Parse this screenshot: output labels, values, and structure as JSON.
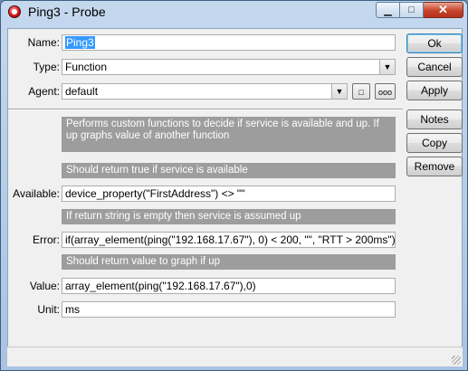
{
  "window": {
    "title": "Ping3 - Probe"
  },
  "form": {
    "name_label": "Name:",
    "name_value": "Ping3",
    "type_label": "Type:",
    "type_value": "Function",
    "agent_label": "Agent:",
    "agent_value": "default",
    "agent_btn1": "□",
    "agent_btn2": "ooo",
    "info_description": "Performs custom functions to decide if service is available and up. If up graphs value of another function",
    "info_available": "Should return true if service is available",
    "available_label": "Available:",
    "available_value": "device_property(\"FirstAddress\") <> \"\"",
    "info_error": "If return string is empty then service is assumed up",
    "error_label": "Error:",
    "error_value": "if(array_element(ping(\"192.168.17.67\"), 0) < 200, \"\", \"RTT > 200ms\")",
    "info_value": "Should return value to graph if up",
    "value_label": "Value:",
    "value_value": "array_element(ping(\"192.168.17.67\"),0)",
    "unit_label": "Unit:",
    "unit_value": "ms"
  },
  "buttons": {
    "ok": "Ok",
    "cancel": "Cancel",
    "apply": "Apply",
    "notes": "Notes",
    "copy": "Copy",
    "remove": "Remove"
  },
  "icons": {
    "app": "probe-icon",
    "minimize": "minimize-icon",
    "maximize": "maximize-icon",
    "close": "close-icon",
    "dropdown": "chevron-down-icon"
  },
  "colors": {
    "info_banner": "#9d9d9d",
    "selection": "#3399ff",
    "close_button": "#c7442b"
  }
}
